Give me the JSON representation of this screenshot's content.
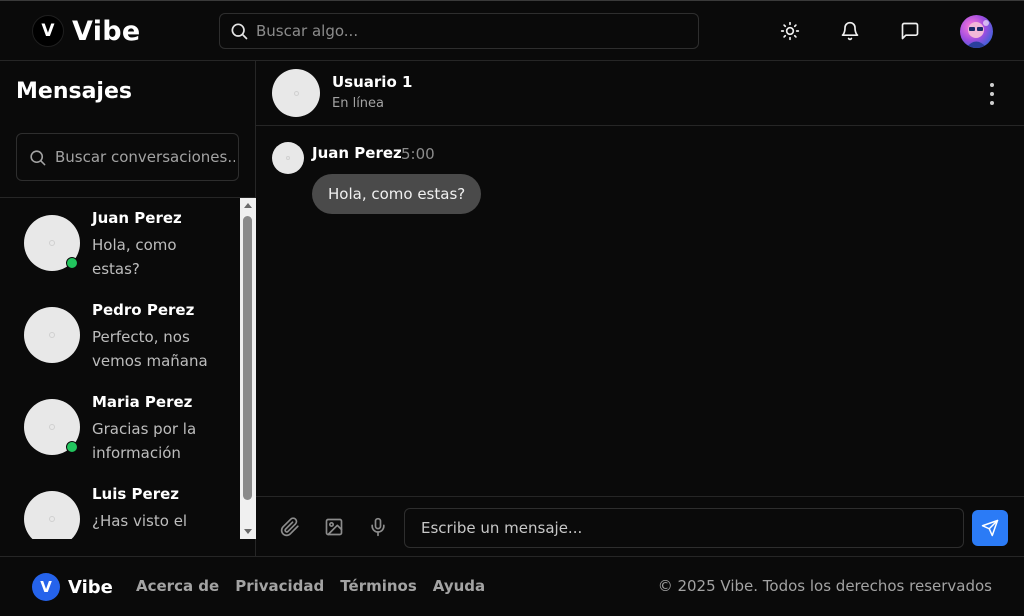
{
  "header": {
    "logo_letter": "V",
    "brand": "Vibe",
    "search_placeholder": "Buscar algo...",
    "icons": [
      "sun-icon",
      "bell-icon",
      "message-icon"
    ]
  },
  "sidebar": {
    "title": "Mensajes",
    "search_placeholder": "Buscar conversaciones...",
    "conversations": [
      {
        "name": "Juan Perez",
        "preview": "Hola, como estas?",
        "online": true
      },
      {
        "name": "Pedro Perez",
        "preview": "Perfecto, nos vemos mañana",
        "online": false
      },
      {
        "name": "Maria Perez",
        "preview": "Gracias por la información",
        "online": true
      },
      {
        "name": "Luis Perez",
        "preview": "¿Has visto el nuevo proyecto?",
        "online": false
      }
    ]
  },
  "chat": {
    "contact_name": "Usuario 1",
    "contact_status": "En línea",
    "messages": [
      {
        "sender": "Juan Perez",
        "time": "5:00",
        "text": "Hola, como estas?"
      }
    ],
    "input_placeholder": "Escribe un mensaje..."
  },
  "footer": {
    "logo_letter": "V",
    "brand": "Vibe",
    "links": [
      "Acerca de",
      "Privacidad",
      "Términos",
      "Ayuda"
    ],
    "copyright": "© 2025 Vibe. Todos los derechos reservados"
  },
  "colors": {
    "background": "#0a0a0a",
    "accent": "#2b7bf6",
    "online": "#22c55e",
    "bubble": "#4a4a4a"
  }
}
